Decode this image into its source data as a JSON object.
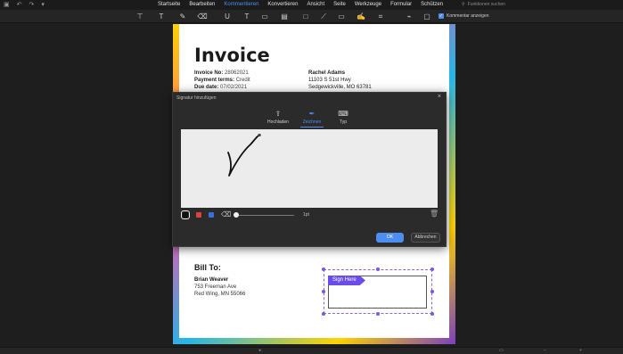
{
  "menubar": {
    "items": [
      "Startseite",
      "Bearbeiten",
      "Kommentieren",
      "Konvertieren",
      "Ansicht",
      "Seite",
      "Werkzeuge",
      "Formular",
      "Schützen"
    ],
    "active_index": 2,
    "search_placeholder": "Funktionen suchen",
    "search_icon": "search-icon"
  },
  "toolbar": {
    "show_comments_label": "Kommentar anzeigen",
    "show_comments_checked": true
  },
  "invoice": {
    "title": "Invoice",
    "invoice_no_label": "Invoice No:",
    "invoice_no": "28062021",
    "payment_terms_label": "Payment terms:",
    "payment_terms": "Credit",
    "due_date_label": "Due date:",
    "due_date": "07/02/2021",
    "client_name": "Rachel Adams",
    "client_street": "11103 S 51st Hwy",
    "client_city": "Sedgewickville, MO 63781",
    "bill_to_title": "Bill To:",
    "bill_name": "Brian Weaver",
    "bill_street": "753 Freeman Ave",
    "bill_city": "Red Wing, MN 55066",
    "sign_here": "Sign Here"
  },
  "dialog": {
    "title": "Signatur hinzufügen",
    "tabs": [
      {
        "label": "Hochladen",
        "icon": "upload-icon"
      },
      {
        "label": "Zeichnen",
        "icon": "draw-pen-icon"
      },
      {
        "label": "Typ",
        "icon": "keyboard-icon"
      }
    ],
    "active_tab": 1,
    "colors": [
      "#111111",
      "#e0413b",
      "#3e6fd8"
    ],
    "selected_color": 0,
    "stroke_width": "1pt",
    "ok_label": "OK",
    "cancel_label": "Abbrechen"
  }
}
